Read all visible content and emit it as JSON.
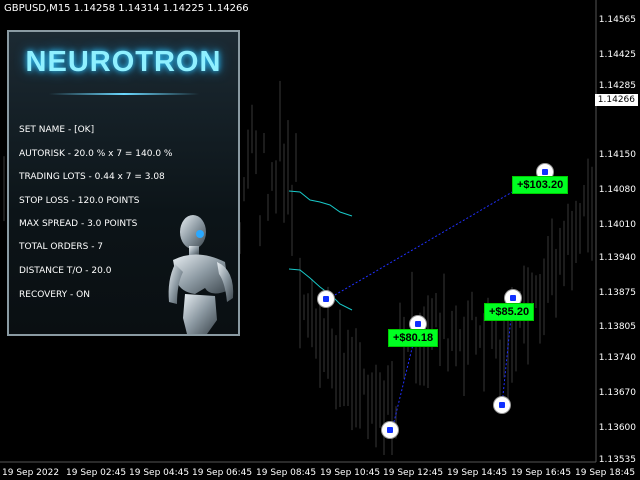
{
  "header": {
    "text": "GBPUSD,M15  1.14258 1.14314 1.14225 1.14266"
  },
  "price_axis": [
    "1.14565",
    "1.14425",
    "1.14285",
    "1.14150",
    "1.14080",
    "1.14010",
    "1.13940",
    "1.13875",
    "1.13805",
    "1.13740",
    "1.13670",
    "1.13600",
    "1.13535"
  ],
  "current_price": "1.14266",
  "time_axis": [
    "19 Sep 2022",
    "19 Sep 02:45",
    "19 Sep 04:45",
    "19 Sep 06:45",
    "19 Sep 08:45",
    "19 Sep 10:45",
    "19 Sep 12:45",
    "19 Sep 14:45",
    "19 Sep 16:45",
    "19 Sep 18:45"
  ],
  "panel": {
    "title": "NEUROTRON",
    "rows": [
      "SET NAME -   [OK]",
      "AUTORISK  -  20.0 % x 7 = 140.0 %",
      "TRADING LOTS  -  0.44 x 7 = 3.08",
      "STOP LOSS  -  120.0 POINTS",
      "MAX SPREAD  -  3.0 POINTS",
      "TOTAL ORDERS  -  7",
      "DISTANCE T/O  -  20.0",
      "RECOVERY  -  ON"
    ]
  },
  "profits": [
    "+$80.18",
    "+$85.20",
    "+$103.20"
  ],
  "colors": {
    "background": "#000000",
    "candles": "#2a2a2a",
    "line": "#18c8c8",
    "profit": "#00ff22",
    "trade_line": "#2030ff"
  }
}
